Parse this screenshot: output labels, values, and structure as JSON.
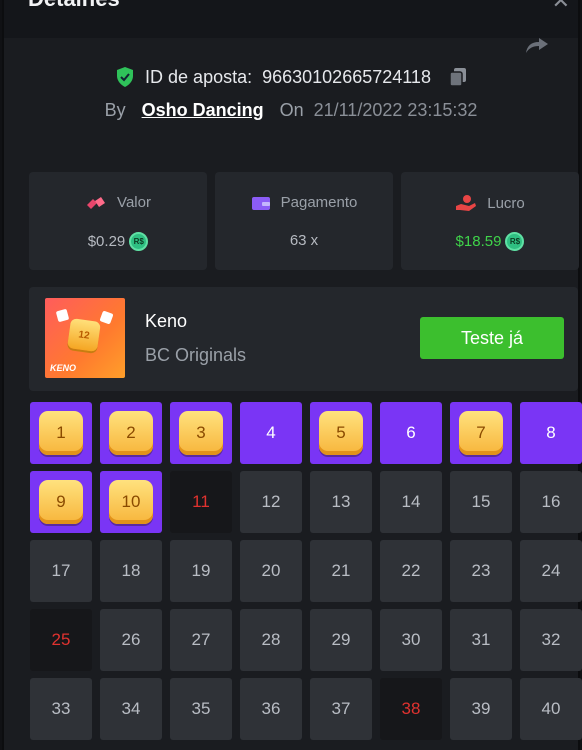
{
  "header": {
    "title": "Detalhes"
  },
  "bet": {
    "id_label": "ID de aposta:",
    "id_value": "96630102665724118",
    "by_label": "By",
    "username": "Osho Dancing",
    "on_label": "On",
    "datetime": "21/11/2022 23:15:32"
  },
  "stats": {
    "amount": {
      "label": "Valor",
      "value": "$0.29",
      "currency": "R$"
    },
    "payout": {
      "label": "Pagamento",
      "value": "63 x"
    },
    "profit": {
      "label": "Lucro",
      "value": "$18.59",
      "currency": "R$"
    }
  },
  "game": {
    "name": "Keno",
    "provider": "BC Originals",
    "thumb_text": "KENO",
    "thumb_number": "12",
    "try_label": "Teste já"
  },
  "colors": {
    "accent_purple": "#7a35f5",
    "green": "#3cbf2e",
    "miss_red": "#e0322f"
  },
  "grid": {
    "cells": [
      {
        "n": "1",
        "state": "hit"
      },
      {
        "n": "2",
        "state": "hit"
      },
      {
        "n": "3",
        "state": "hit"
      },
      {
        "n": "4",
        "state": "selected"
      },
      {
        "n": "5",
        "state": "hit"
      },
      {
        "n": "6",
        "state": "selected"
      },
      {
        "n": "7",
        "state": "hit"
      },
      {
        "n": "8",
        "state": "selected"
      },
      {
        "n": "9",
        "state": "hit"
      },
      {
        "n": "10",
        "state": "hit"
      },
      {
        "n": "11",
        "state": "miss"
      },
      {
        "n": "12",
        "state": "empty"
      },
      {
        "n": "13",
        "state": "empty"
      },
      {
        "n": "14",
        "state": "empty"
      },
      {
        "n": "15",
        "state": "empty"
      },
      {
        "n": "16",
        "state": "empty"
      },
      {
        "n": "17",
        "state": "empty"
      },
      {
        "n": "18",
        "state": "empty"
      },
      {
        "n": "19",
        "state": "empty"
      },
      {
        "n": "20",
        "state": "empty"
      },
      {
        "n": "21",
        "state": "empty"
      },
      {
        "n": "22",
        "state": "empty"
      },
      {
        "n": "23",
        "state": "empty"
      },
      {
        "n": "24",
        "state": "empty"
      },
      {
        "n": "25",
        "state": "miss"
      },
      {
        "n": "26",
        "state": "empty"
      },
      {
        "n": "27",
        "state": "empty"
      },
      {
        "n": "28",
        "state": "empty"
      },
      {
        "n": "29",
        "state": "empty"
      },
      {
        "n": "30",
        "state": "empty"
      },
      {
        "n": "31",
        "state": "empty"
      },
      {
        "n": "32",
        "state": "empty"
      },
      {
        "n": "33",
        "state": "empty"
      },
      {
        "n": "34",
        "state": "empty"
      },
      {
        "n": "35",
        "state": "empty"
      },
      {
        "n": "36",
        "state": "empty"
      },
      {
        "n": "37",
        "state": "empty"
      },
      {
        "n": "38",
        "state": "miss"
      },
      {
        "n": "39",
        "state": "empty"
      },
      {
        "n": "40",
        "state": "empty"
      }
    ]
  }
}
